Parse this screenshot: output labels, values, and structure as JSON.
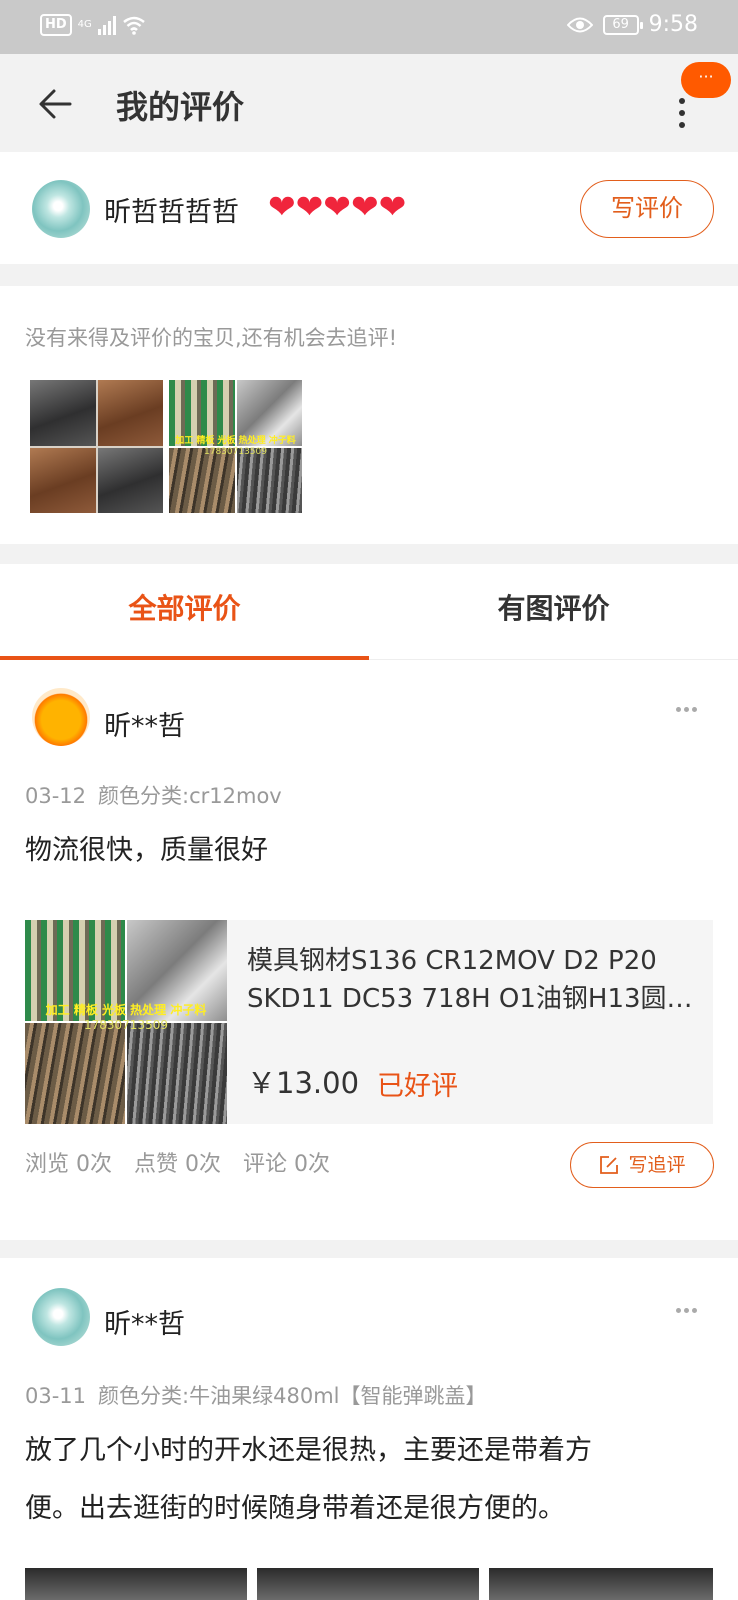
{
  "status_bar": {
    "hd": "HD",
    "network": "4G",
    "battery": "69",
    "time": "9:58",
    "icons": [
      "signal-icon",
      "wifi-icon",
      "eye-icon",
      "battery-icon"
    ]
  },
  "header": {
    "title": "我的评价",
    "back_icon": "arrow-left-icon",
    "more_icon": "vertical-dots-icon",
    "message_badge": "···"
  },
  "profile": {
    "nickname": "昕哲哲哲哲",
    "hearts": "❤❤❤❤❤",
    "heart_count": 5,
    "write_review_label": "写评价"
  },
  "followup": {
    "tip": "没有来得及评价的宝贝,还有机会去追评!",
    "thumb_captions": {
      "line1": "加工 精板 光板 热处理 冲子料",
      "line2": "17830713509"
    }
  },
  "tabs": [
    {
      "label": "全部评价",
      "active": true
    },
    {
      "label": "有图评价",
      "active": false
    }
  ],
  "reviews": [
    {
      "user": "昕**哲",
      "date": "03-12",
      "sku": "颜色分类:cr12mov",
      "text": "物流很快，质量很好",
      "product": {
        "name_line1": "模具钢材S136 CR12MOV D2 P20",
        "name_line2": "SKD11 DC53 718H O1油钢H13圆…",
        "price": "￥13.00",
        "status": "已好评",
        "caption_line1": "加工 精板 光板 热处理 冲子料",
        "caption_line2": "17830713509"
      },
      "stats": {
        "views": "浏览 0次",
        "likes": "点赞 0次",
        "comments": "评论 0次"
      },
      "followup_label": "写追评"
    },
    {
      "user": "昕**哲",
      "date": "03-11",
      "sku": "颜色分类:牛油果绿480ml【智能弹跳盖】",
      "text_line1": "放了几个小时的开水还是很热，主要还是带着方",
      "text_line2": "便。出去逛街的时候随身带着还是很方便的。"
    }
  ],
  "colors": {
    "accent": "#e95316",
    "heart": "#f0253c",
    "status_bar": "#c9c9c9",
    "background": "#f2f2f2"
  }
}
